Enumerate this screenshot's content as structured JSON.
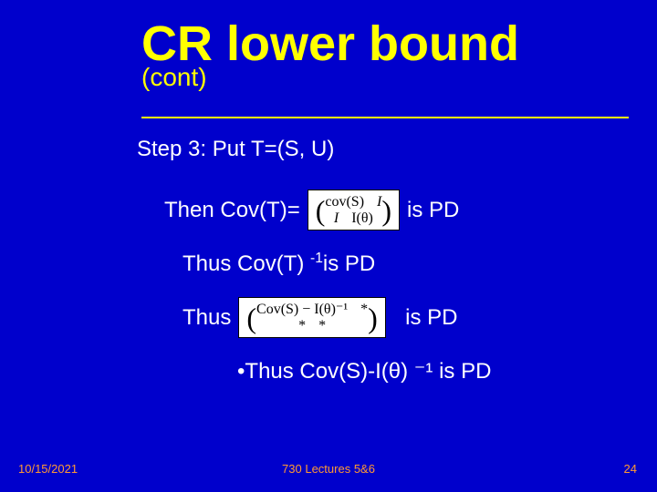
{
  "title": {
    "line1": "CR  lower bound",
    "line2": "(cont)"
  },
  "body": {
    "step": "Step 3: Put T=(S, U)",
    "then_prefix": "Then Cov(T)=",
    "is_pd": "is PD",
    "matrix1": {
      "r1c1": "cov(S)",
      "r1c2": "I",
      "r2c1": "I",
      "r2c2": "I(θ)"
    },
    "thus1_prefix": "Thus  Cov(T)",
    "thus1_exp": "-1",
    "thus1_suffix": " is PD",
    "thus2_prefix": "Thus",
    "matrix2": {
      "r1c1": "Cov(S) − I(θ)⁻¹",
      "r1c2": "*",
      "r2c1": "*",
      "r2c2": "*"
    },
    "bullet": "•Thus Cov(S)-I(θ) ⁻¹ is PD"
  },
  "footer": {
    "date": "10/15/2021",
    "center": "730 Lectures 5&6",
    "num": "24"
  }
}
